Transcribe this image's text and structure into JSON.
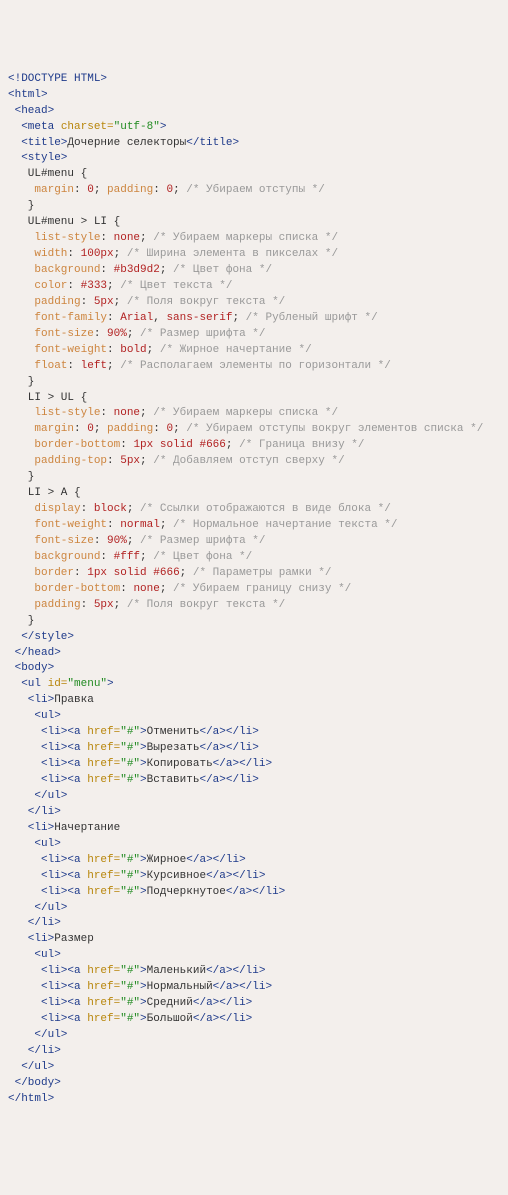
{
  "lines": [
    [
      [
        "tag",
        "<!DOCTYPE HTML>"
      ]
    ],
    [
      [
        "tag",
        "<html>"
      ]
    ],
    [
      [
        "tag",
        " <head>"
      ]
    ],
    [
      [
        "tag",
        "  <meta "
      ],
      [
        "attr",
        "charset="
      ],
      [
        "val",
        "\"utf-8\""
      ],
      [
        "tag",
        ">"
      ]
    ],
    [
      [
        "tag",
        "  <title>"
      ],
      [
        "txt",
        "Дочерние селекторы"
      ],
      [
        "tag",
        "</title>"
      ]
    ],
    [
      [
        "tag",
        "  <style>"
      ]
    ],
    [
      [
        "sel",
        "   UL#menu {"
      ]
    ],
    [
      [
        "sel",
        "    "
      ],
      [
        "prop",
        "margin"
      ],
      [
        "sel",
        ": "
      ],
      [
        "num",
        "0"
      ],
      [
        "sel",
        "; "
      ],
      [
        "prop",
        "padding"
      ],
      [
        "sel",
        ": "
      ],
      [
        "num",
        "0"
      ],
      [
        "sel",
        "; "
      ],
      [
        "cmt",
        "/* Убираем отступы */"
      ]
    ],
    [
      [
        "sel",
        "   }"
      ]
    ],
    [
      [
        "sel",
        "   UL#menu > LI {"
      ]
    ],
    [
      [
        "sel",
        "    "
      ],
      [
        "prop",
        "list-style"
      ],
      [
        "sel",
        ": "
      ],
      [
        "num",
        "none"
      ],
      [
        "sel",
        "; "
      ],
      [
        "cmt",
        "/* Убираем маркеры списка */"
      ]
    ],
    [
      [
        "sel",
        "    "
      ],
      [
        "prop",
        "width"
      ],
      [
        "sel",
        ": "
      ],
      [
        "num",
        "100px"
      ],
      [
        "sel",
        "; "
      ],
      [
        "cmt",
        "/* Ширина элемента в пикселах */"
      ]
    ],
    [
      [
        "sel",
        "    "
      ],
      [
        "prop",
        "background"
      ],
      [
        "sel",
        ": "
      ],
      [
        "num",
        "#b3d9d2"
      ],
      [
        "sel",
        "; "
      ],
      [
        "cmt",
        "/* Цвет фона */"
      ]
    ],
    [
      [
        "sel",
        "    "
      ],
      [
        "prop",
        "color"
      ],
      [
        "sel",
        ": "
      ],
      [
        "num",
        "#333"
      ],
      [
        "sel",
        "; "
      ],
      [
        "cmt",
        "/* Цвет текста */"
      ]
    ],
    [
      [
        "sel",
        "    "
      ],
      [
        "prop",
        "padding"
      ],
      [
        "sel",
        ": "
      ],
      [
        "num",
        "5px"
      ],
      [
        "sel",
        "; "
      ],
      [
        "cmt",
        "/* Поля вокруг текста */"
      ]
    ],
    [
      [
        "sel",
        "    "
      ],
      [
        "prop",
        "font-family"
      ],
      [
        "sel",
        ": "
      ],
      [
        "num",
        "Arial"
      ],
      [
        "sel",
        ", "
      ],
      [
        "num",
        "sans-serif"
      ],
      [
        "sel",
        "; "
      ],
      [
        "cmt",
        "/* Рубленый шрифт */"
      ]
    ],
    [
      [
        "sel",
        "    "
      ],
      [
        "prop",
        "font-size"
      ],
      [
        "sel",
        ": "
      ],
      [
        "num",
        "90%"
      ],
      [
        "sel",
        "; "
      ],
      [
        "cmt",
        "/* Размер шрифта */"
      ]
    ],
    [
      [
        "sel",
        "    "
      ],
      [
        "prop",
        "font-weight"
      ],
      [
        "sel",
        ": "
      ],
      [
        "num",
        "bold"
      ],
      [
        "sel",
        "; "
      ],
      [
        "cmt",
        "/* Жирное начертание */"
      ]
    ],
    [
      [
        "sel",
        "    "
      ],
      [
        "prop",
        "float"
      ],
      [
        "sel",
        ": "
      ],
      [
        "num",
        "left"
      ],
      [
        "sel",
        "; "
      ],
      [
        "cmt",
        "/* Располагаем элементы по горизонтали */"
      ]
    ],
    [
      [
        "sel",
        "   }"
      ]
    ],
    [
      [
        "sel",
        "   LI > UL {"
      ]
    ],
    [
      [
        "sel",
        "    "
      ],
      [
        "prop",
        "list-style"
      ],
      [
        "sel",
        ": "
      ],
      [
        "num",
        "none"
      ],
      [
        "sel",
        "; "
      ],
      [
        "cmt",
        "/* Убираем маркеры списка */"
      ]
    ],
    [
      [
        "sel",
        "    "
      ],
      [
        "prop",
        "margin"
      ],
      [
        "sel",
        ": "
      ],
      [
        "num",
        "0"
      ],
      [
        "sel",
        "; "
      ],
      [
        "prop",
        "padding"
      ],
      [
        "sel",
        ": "
      ],
      [
        "num",
        "0"
      ],
      [
        "sel",
        "; "
      ],
      [
        "cmt",
        "/* Убираем отступы вокруг элементов списка */"
      ]
    ],
    [
      [
        "sel",
        "    "
      ],
      [
        "prop",
        "border-bottom"
      ],
      [
        "sel",
        ": "
      ],
      [
        "num",
        "1px"
      ],
      [
        "sel",
        " "
      ],
      [
        "num",
        "solid"
      ],
      [
        "sel",
        " "
      ],
      [
        "num",
        "#666"
      ],
      [
        "sel",
        "; "
      ],
      [
        "cmt",
        "/* Граница внизу */"
      ]
    ],
    [
      [
        "sel",
        "    "
      ],
      [
        "prop",
        "padding-top"
      ],
      [
        "sel",
        ": "
      ],
      [
        "num",
        "5px"
      ],
      [
        "sel",
        "; "
      ],
      [
        "cmt",
        "/* Добавляем отступ сверху */"
      ]
    ],
    [
      [
        "sel",
        "   }"
      ]
    ],
    [
      [
        "sel",
        "   LI > A {"
      ]
    ],
    [
      [
        "sel",
        "    "
      ],
      [
        "prop",
        "display"
      ],
      [
        "sel",
        ": "
      ],
      [
        "num",
        "block"
      ],
      [
        "sel",
        "; "
      ],
      [
        "cmt",
        "/* Ссылки отображаются в виде блока */"
      ]
    ],
    [
      [
        "sel",
        "    "
      ],
      [
        "prop",
        "font-weight"
      ],
      [
        "sel",
        ": "
      ],
      [
        "num",
        "normal"
      ],
      [
        "sel",
        "; "
      ],
      [
        "cmt",
        "/* Нормальное начертание текста */"
      ]
    ],
    [
      [
        "sel",
        "    "
      ],
      [
        "prop",
        "font-size"
      ],
      [
        "sel",
        ": "
      ],
      [
        "num",
        "90%"
      ],
      [
        "sel",
        "; "
      ],
      [
        "cmt",
        "/* Размер шрифта */"
      ]
    ],
    [
      [
        "sel",
        "    "
      ],
      [
        "prop",
        "background"
      ],
      [
        "sel",
        ": "
      ],
      [
        "num",
        "#fff"
      ],
      [
        "sel",
        "; "
      ],
      [
        "cmt",
        "/* Цвет фона */"
      ]
    ],
    [
      [
        "sel",
        "    "
      ],
      [
        "prop",
        "border"
      ],
      [
        "sel",
        ": "
      ],
      [
        "num",
        "1px"
      ],
      [
        "sel",
        " "
      ],
      [
        "num",
        "solid"
      ],
      [
        "sel",
        " "
      ],
      [
        "num",
        "#666"
      ],
      [
        "sel",
        "; "
      ],
      [
        "cmt",
        "/* Параметры рамки */"
      ]
    ],
    [
      [
        "sel",
        "    "
      ],
      [
        "prop",
        "border-bottom"
      ],
      [
        "sel",
        ": "
      ],
      [
        "num",
        "none"
      ],
      [
        "sel",
        "; "
      ],
      [
        "cmt",
        "/* Убираем границу снизу */"
      ]
    ],
    [
      [
        "sel",
        "    "
      ],
      [
        "prop",
        "padding"
      ],
      [
        "sel",
        ": "
      ],
      [
        "num",
        "5px"
      ],
      [
        "sel",
        "; "
      ],
      [
        "cmt",
        "/* Поля вокруг текста */"
      ]
    ],
    [
      [
        "sel",
        "   }"
      ]
    ],
    [
      [
        "tag",
        "  </style>"
      ]
    ],
    [
      [
        "tag",
        " </head>"
      ]
    ],
    [
      [
        "tag",
        " <body>"
      ]
    ],
    [
      [
        "tag",
        "  <ul "
      ],
      [
        "attr",
        "id="
      ],
      [
        "val",
        "\"menu\""
      ],
      [
        "tag",
        ">"
      ]
    ],
    [
      [
        "tag",
        "   <li>"
      ],
      [
        "txt",
        "Правка"
      ]
    ],
    [
      [
        "tag",
        "    <ul>"
      ]
    ],
    [
      [
        "tag",
        "     <li><a "
      ],
      [
        "attr",
        "href="
      ],
      [
        "val",
        "\"#\""
      ],
      [
        "tag",
        ">"
      ],
      [
        "txt",
        "Отменить"
      ],
      [
        "tag",
        "</a></li>"
      ]
    ],
    [
      [
        "tag",
        "     <li><a "
      ],
      [
        "attr",
        "href="
      ],
      [
        "val",
        "\"#\""
      ],
      [
        "tag",
        ">"
      ],
      [
        "txt",
        "Вырезать"
      ],
      [
        "tag",
        "</a></li>"
      ]
    ],
    [
      [
        "tag",
        "     <li><a "
      ],
      [
        "attr",
        "href="
      ],
      [
        "val",
        "\"#\""
      ],
      [
        "tag",
        ">"
      ],
      [
        "txt",
        "Копировать"
      ],
      [
        "tag",
        "</a></li>"
      ]
    ],
    [
      [
        "tag",
        "     <li><a "
      ],
      [
        "attr",
        "href="
      ],
      [
        "val",
        "\"#\""
      ],
      [
        "tag",
        ">"
      ],
      [
        "txt",
        "Вставить"
      ],
      [
        "tag",
        "</a></li>"
      ]
    ],
    [
      [
        "tag",
        "    </ul>"
      ]
    ],
    [
      [
        "tag",
        "   </li>"
      ]
    ],
    [
      [
        "tag",
        "   <li>"
      ],
      [
        "txt",
        "Начертание"
      ]
    ],
    [
      [
        "tag",
        "    <ul>"
      ]
    ],
    [
      [
        "tag",
        "     <li><a "
      ],
      [
        "attr",
        "href="
      ],
      [
        "val",
        "\"#\""
      ],
      [
        "tag",
        ">"
      ],
      [
        "txt",
        "Жирное"
      ],
      [
        "tag",
        "</a></li>"
      ]
    ],
    [
      [
        "tag",
        "     <li><a "
      ],
      [
        "attr",
        "href="
      ],
      [
        "val",
        "\"#\""
      ],
      [
        "tag",
        ">"
      ],
      [
        "txt",
        "Курсивное"
      ],
      [
        "tag",
        "</a></li>"
      ]
    ],
    [
      [
        "tag",
        "     <li><a "
      ],
      [
        "attr",
        "href="
      ],
      [
        "val",
        "\"#\""
      ],
      [
        "tag",
        ">"
      ],
      [
        "txt",
        "Подчеркнутое"
      ],
      [
        "tag",
        "</a></li>"
      ]
    ],
    [
      [
        "tag",
        "    </ul>"
      ]
    ],
    [
      [
        "tag",
        "   </li>"
      ]
    ],
    [
      [
        "tag",
        "   <li>"
      ],
      [
        "txt",
        "Размер"
      ]
    ],
    [
      [
        "tag",
        "    <ul>"
      ]
    ],
    [
      [
        "tag",
        "     <li><a "
      ],
      [
        "attr",
        "href="
      ],
      [
        "val",
        "\"#\""
      ],
      [
        "tag",
        ">"
      ],
      [
        "txt",
        "Маленький"
      ],
      [
        "tag",
        "</a></li>"
      ]
    ],
    [
      [
        "tag",
        "     <li><a "
      ],
      [
        "attr",
        "href="
      ],
      [
        "val",
        "\"#\""
      ],
      [
        "tag",
        ">"
      ],
      [
        "txt",
        "Нормальный"
      ],
      [
        "tag",
        "</a></li>"
      ]
    ],
    [
      [
        "tag",
        "     <li><a "
      ],
      [
        "attr",
        "href="
      ],
      [
        "val",
        "\"#\""
      ],
      [
        "tag",
        ">"
      ],
      [
        "txt",
        "Средний"
      ],
      [
        "tag",
        "</a></li>"
      ]
    ],
    [
      [
        "tag",
        "     <li><a "
      ],
      [
        "attr",
        "href="
      ],
      [
        "val",
        "\"#\""
      ],
      [
        "tag",
        ">"
      ],
      [
        "txt",
        "Большой"
      ],
      [
        "tag",
        "</a></li>"
      ]
    ],
    [
      [
        "tag",
        "    </ul>"
      ]
    ],
    [
      [
        "tag",
        "   </li>"
      ]
    ],
    [
      [
        "tag",
        "  </ul>"
      ]
    ],
    [
      [
        "tag",
        " </body>"
      ]
    ],
    [
      [
        "tag",
        "</html>"
      ]
    ]
  ]
}
